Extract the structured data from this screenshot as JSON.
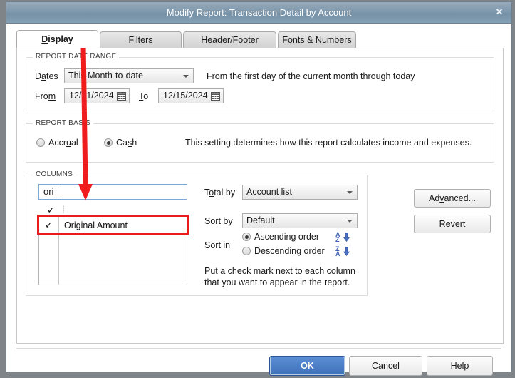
{
  "window": {
    "title": "Modify Report: Transaction Detail by Account",
    "close_icon": "close-icon",
    "close_glyph": "✕"
  },
  "tabs": [
    {
      "label": "Display",
      "mnemonic": "D",
      "active": true
    },
    {
      "label": "Filters",
      "mnemonic": "F",
      "active": false
    },
    {
      "label": "Header/Footer",
      "mnemonic": "H",
      "active": false
    },
    {
      "label": "Fonts & Numbers",
      "mnemonic": "n",
      "active": false
    }
  ],
  "report_date_range": {
    "group_label": "REPORT DATE RANGE",
    "dates_label": "Dates",
    "dates_value": "This Month-to-date",
    "description": "From the first day of the current month through today",
    "from_label": "From",
    "from_value": "12/01/2024",
    "to_label": "To",
    "to_value": "12/15/2024",
    "calendar_icon": "calendar-icon"
  },
  "report_basis": {
    "group_label": "REPORT BASIS",
    "accrual_label": "Accrual",
    "cash_label": "Cash",
    "selected": "Cash",
    "description": "This setting determines how this report calculates income and expenses."
  },
  "columns": {
    "group_label": "COLUMNS",
    "search_value": "ori",
    "header_check_glyph": "✓",
    "list_items": [
      {
        "name": "Original Amount",
        "checked": true,
        "check_glyph": "✓",
        "highlighted": true
      }
    ],
    "total_by_label": "Total by",
    "total_by_value": "Account list",
    "sort_by_label": "Sort by",
    "sort_by_value": "Default",
    "sort_in_label": "Sort in",
    "ascending_label": "Ascending order",
    "descending_label": "Descending order",
    "sort_order_selected": "Ascending order",
    "ascending_icon": "sort-ascending-az-icon",
    "descending_icon": "sort-descending-za-icon",
    "hint_line1": "Put a check mark next to each column",
    "hint_line2": "that you want to appear in the report."
  },
  "side_buttons": {
    "advanced": "Advanced...",
    "advanced_mnemonic": "v",
    "revert": "Revert",
    "revert_mnemonic": "e"
  },
  "footer_buttons": {
    "ok": "OK",
    "cancel": "Cancel",
    "help": "Help"
  },
  "annotation": {
    "arrow_color": "#ee1c1c",
    "arrow_name": "red-annotation-arrow"
  },
  "colors": {
    "titlebar": "#8099ad",
    "primary_button": "#3f6fba",
    "highlight_red": "#e81c1c",
    "focus_border": "#7fa7d6"
  }
}
